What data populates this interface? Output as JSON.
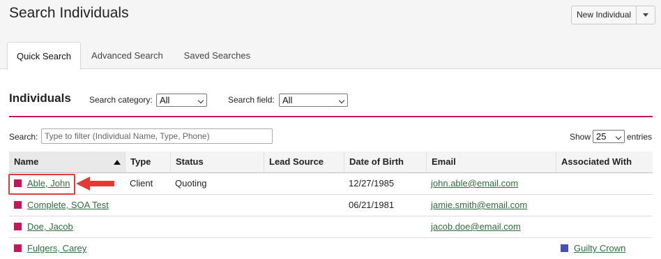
{
  "header": {
    "title": "Search Individuals",
    "new_button": "New Individual"
  },
  "tabs": [
    {
      "label": "Quick Search",
      "active": true
    },
    {
      "label": "Advanced Search",
      "active": false
    },
    {
      "label": "Saved Searches",
      "active": false
    }
  ],
  "section": {
    "title": "Individuals",
    "category_label": "Search category:",
    "category_value": "All",
    "field_label": "Search field:",
    "field_value": "All"
  },
  "search": {
    "label": "Search:",
    "placeholder": "Type to filter (Individual Name, Type, Phone)",
    "value": ""
  },
  "paging": {
    "show_label": "Show",
    "show_value": "25",
    "entries_label": "entries"
  },
  "table": {
    "columns": [
      "Name",
      "Type",
      "Status",
      "Lead Source",
      "Date of Birth",
      "Email",
      "Associated With"
    ],
    "sort_column": "Name",
    "sort_direction": "ascending",
    "rows": [
      {
        "name": "Able, John",
        "type": "Client",
        "status": "Quoting",
        "lead_source": "",
        "dob": "12/27/1985",
        "email": "john.able@email.com",
        "associated": ""
      },
      {
        "name": "Complete, SOA Test",
        "type": "",
        "status": "",
        "lead_source": "",
        "dob": "06/21/1981",
        "email": "jamie.smith@email.com",
        "associated": ""
      },
      {
        "name": "Doe, Jacob",
        "type": "",
        "status": "",
        "lead_source": "",
        "dob": "",
        "email": "jacob.doe@email.com",
        "associated": ""
      },
      {
        "name": "Fulgers, Carey",
        "type": "",
        "status": "",
        "lead_source": "",
        "dob": "",
        "email": "",
        "associated": "Guilty Crown"
      }
    ]
  },
  "colors": {
    "accent": "#c2185b",
    "individual_swatch": "#c2185b",
    "group_swatch": "#4a4fb5",
    "link": "#2e6d3e",
    "highlight": "#e53935"
  },
  "annotation": {
    "highlighted_row": "Able, John"
  }
}
